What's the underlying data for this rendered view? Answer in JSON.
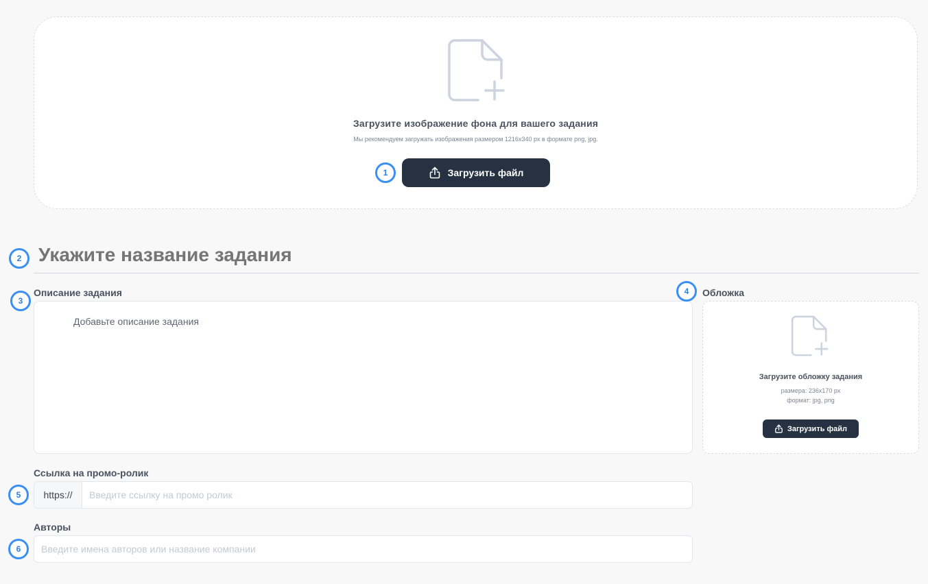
{
  "background_upload": {
    "icon": "file-plus-icon",
    "title": "Загрузите изображение фона для вашего задания",
    "hint": "Мы рекомендуем загружать изображения размером 1216x340 px в формате png, jpg.",
    "button_icon": "upload-icon",
    "button_label": "Загрузить файл"
  },
  "markers": [
    "1",
    "2",
    "3",
    "4",
    "5",
    "6"
  ],
  "task_title": {
    "placeholder": "Укажите название задания"
  },
  "description": {
    "label": "Описание задания",
    "placeholder": "Добавьте описание задания"
  },
  "cover": {
    "label": "Обложка",
    "icon": "file-plus-icon",
    "title": "Загрузите обложку задания",
    "size": "размера: 236x170 px",
    "format": "формат: jpg, png",
    "button_icon": "upload-icon",
    "button_label": "Загрузить файл"
  },
  "promo": {
    "label": "Ссылка на промо-ролик",
    "prefix": "https://",
    "placeholder": "Введите ссылку на промо ролик"
  },
  "authors": {
    "label": "Авторы",
    "placeholder": "Введите имена авторов или название компании"
  },
  "colors": {
    "accent_marker": "#3a8ff2",
    "button_dark": "#263242",
    "background": "#f8f8f9"
  }
}
